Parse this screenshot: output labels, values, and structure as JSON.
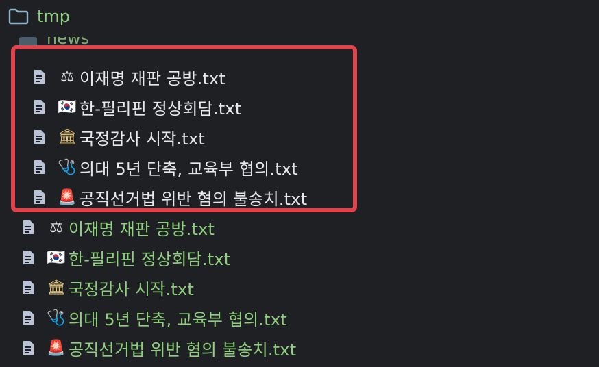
{
  "tree": {
    "root_folder": {
      "label": "tmp",
      "icon": "folder-icon"
    },
    "subfolder": {
      "label": "news",
      "icon": "folder-icon"
    },
    "highlighted_files": [
      {
        "emoji": "⚖",
        "label": "이재명 재판 공방.txt",
        "icon": "file-icon"
      },
      {
        "emoji": "🇰🇷",
        "label": "한-필리핀 정상회담.txt",
        "icon": "file-icon"
      },
      {
        "emoji": "🏛",
        "label": "국정감사 시작.txt",
        "icon": "file-icon"
      },
      {
        "emoji": "🩺",
        "label": "의대 5년 단축, 교육부 협의.txt",
        "icon": "file-icon"
      },
      {
        "emoji": "🚨",
        "label": "공직선거법 위반 혐의 불송치.txt",
        "icon": "file-icon"
      }
    ],
    "files": [
      {
        "emoji": "⚖",
        "label": "이재명 재판 공방.txt",
        "icon": "file-icon"
      },
      {
        "emoji": "🇰🇷",
        "label": "한-필리핀 정상회담.txt",
        "icon": "file-icon"
      },
      {
        "emoji": "🏛",
        "label": "국정감사 시작.txt",
        "icon": "file-icon"
      },
      {
        "emoji": "🩺",
        "label": "의대 5년 단축, 교육부 협의.txt",
        "icon": "file-icon"
      },
      {
        "emoji": "🚨",
        "label": "공직선거법 위반 혐의 불송치.txt",
        "icon": "file-icon"
      }
    ]
  },
  "colors": {
    "background": "#1f2023",
    "folder_text": "#8fd07f",
    "file_text_default": "#e8e8ea",
    "file_text_new": "#8fd07f",
    "highlight": "#e0434c",
    "folder_icon": "#8fb4c9",
    "file_icon": "#b9c2d6"
  }
}
